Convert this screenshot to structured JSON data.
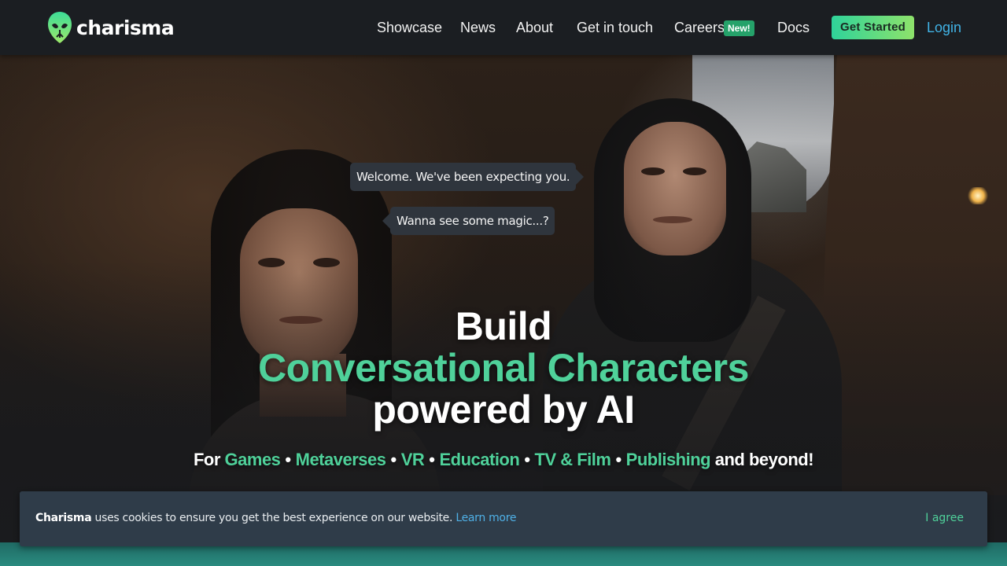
{
  "brand": {
    "name": "charisma",
    "logo_icon": "alien-head-icon",
    "accent": "#4fd19a",
    "link_color": "#41b3e6"
  },
  "nav": {
    "items": [
      {
        "label": "Showcase"
      },
      {
        "label": "News"
      },
      {
        "label": "About"
      },
      {
        "label": "Get in touch"
      },
      {
        "label": "Careers",
        "badge": "New!"
      },
      {
        "label": "Docs"
      }
    ],
    "cta_label": "Get Started",
    "login_label": "Login"
  },
  "hero": {
    "bubbles": [
      "Welcome. We've been expecting you.",
      "Wanna see some magic...?"
    ],
    "headline_1": "Build",
    "headline_2": "Conversational Characters",
    "headline_3": "powered by AI",
    "tagline": {
      "prefix": "For",
      "items": [
        "Games",
        "Metaverses",
        "VR",
        "Education",
        "TV & Film",
        "Publishing"
      ],
      "separator": "•",
      "suffix": "and beyond!"
    }
  },
  "cookie": {
    "brand": "Charisma",
    "text": "uses cookies to ensure you get the best experience on our website.",
    "link_label": "Learn more",
    "agree_label": "I agree"
  }
}
